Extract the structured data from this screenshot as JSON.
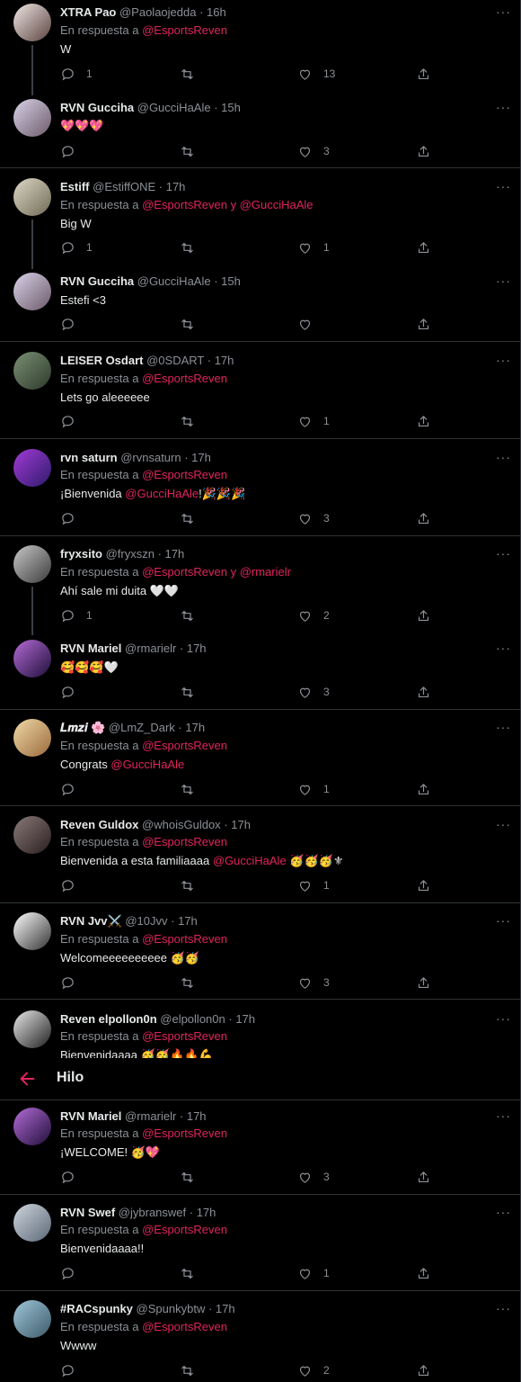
{
  "reply_prefix": "En respuesta a",
  "and_word": "y",
  "hilo": {
    "title": "Hilo"
  },
  "tweets": [
    {
      "name": "XTRA Pao",
      "handle": "@Paolaojedda",
      "time": "16h",
      "reply_to": [
        "@EsportsReven"
      ],
      "text": "W",
      "mention": "",
      "emoji": "",
      "counts": {
        "replies": "1",
        "likes": "13"
      }
    },
    {
      "name": "RVN Gucciha",
      "handle": "@GucciHaAle",
      "time": "15h",
      "reply_to": [],
      "text": "",
      "mention": "",
      "emoji": "💖💖💖",
      "counts": {
        "replies": "",
        "likes": "3"
      }
    },
    {
      "name": "Estiff",
      "handle": "@EstiffONE",
      "time": "17h",
      "reply_to": [
        "@EsportsReven",
        "@GucciHaAle"
      ],
      "text": "Big W",
      "mention": "",
      "emoji": "",
      "counts": {
        "replies": "1",
        "likes": "1"
      }
    },
    {
      "name": "RVN Gucciha",
      "handle": "@GucciHaAle",
      "time": "15h",
      "reply_to": [],
      "text": "Estefi <3",
      "mention": "",
      "emoji": "",
      "counts": {
        "replies": "",
        "likes": ""
      }
    },
    {
      "name": "LEISER Osdart",
      "handle": "@0SDART",
      "time": "17h",
      "reply_to": [
        "@EsportsReven"
      ],
      "text": "Lets go aleeeeee",
      "mention": "",
      "emoji": "",
      "counts": {
        "replies": "",
        "likes": "1"
      }
    },
    {
      "name": "rvn saturn",
      "handle": "@rvnsaturn",
      "time": "17h",
      "reply_to": [
        "@EsportsReven"
      ],
      "text": "¡Bienvenida ",
      "mention": "@GucciHaAle",
      "text_after": "!",
      "emoji": "🎉🎉🎉",
      "counts": {
        "replies": "",
        "likes": "3"
      }
    },
    {
      "name": "fryxsito",
      "handle": "@fryxszn",
      "time": "17h",
      "reply_to": [
        "@EsportsReven",
        "@rmarielr"
      ],
      "text": "Ahí sale mi duita ",
      "mention": "",
      "emoji": "🤍🤍",
      "counts": {
        "replies": "1",
        "likes": "2"
      }
    },
    {
      "name": "RVN Mariel",
      "handle": "@rmarielr",
      "time": "17h",
      "reply_to": [],
      "text": "",
      "mention": "",
      "emoji": "🥰🥰🥰🤍",
      "counts": {
        "replies": "",
        "likes": "3"
      }
    },
    {
      "name": "𝑳𝒎𝒛𝒊 🌸",
      "handle": "@LmZ_Dark",
      "time": "17h",
      "reply_to": [
        "@EsportsReven"
      ],
      "text": "Congrats ",
      "mention": "@GucciHaAle",
      "text_after": "",
      "emoji": "",
      "counts": {
        "replies": "",
        "likes": "1"
      }
    },
    {
      "name": "Reven Guldox",
      "handle": "@whoisGuldox",
      "time": "17h",
      "reply_to": [
        "@EsportsReven"
      ],
      "text": "Bienvenida a esta familiaaaa ",
      "mention": "@GucciHaAle",
      "text_after": " ",
      "emoji": "🥳🥳🥳⚜",
      "counts": {
        "replies": "",
        "likes": "1"
      }
    },
    {
      "name": "RVN Jvv⚔️",
      "handle": "@10Jvv",
      "time": "17h",
      "reply_to": [
        "@EsportsReven"
      ],
      "text": "Welcomeeeeeeeeee ",
      "mention": "",
      "emoji": "🥳🥳",
      "counts": {
        "replies": "",
        "likes": "3"
      }
    },
    {
      "name": "Reven elpollon0n",
      "handle": "@elpollon0n",
      "time": "17h",
      "reply_to": [
        "@EsportsReven"
      ],
      "text": "Bienvenidaaaa ",
      "mention": "",
      "emoji": "🥳🥳🔥🔥💪",
      "counts": {
        "replies": "",
        "likes": ""
      }
    },
    {
      "name": "RVN Mariel",
      "handle": "@rmarielr",
      "time": "17h",
      "reply_to": [
        "@EsportsReven"
      ],
      "text": "¡WELCOME! ",
      "mention": "",
      "emoji": "🥳💖",
      "counts": {
        "replies": "",
        "likes": "3"
      }
    },
    {
      "name": "RVN Swef",
      "handle": "@jybranswef",
      "time": "17h",
      "reply_to": [
        "@EsportsReven"
      ],
      "text": "Bienvenidaaaa!!",
      "mention": "",
      "emoji": "",
      "counts": {
        "replies": "",
        "likes": "1"
      }
    },
    {
      "name": "#RACspunky",
      "handle": "@Spunkybtw",
      "time": "17h",
      "reply_to": [
        "@EsportsReven"
      ],
      "text": "Wwww",
      "mention": "",
      "emoji": "",
      "counts": {
        "replies": "",
        "likes": "2"
      }
    }
  ],
  "colors": {
    "accent": "#e0245e",
    "bg": "#000000",
    "muted": "#8b9096",
    "text": "#e7e9ea"
  },
  "icons": {
    "reply": "reply-icon",
    "retweet": "retweet-icon",
    "like": "like-icon",
    "share": "share-icon",
    "more": "more-icon",
    "back": "back-arrow-icon"
  }
}
